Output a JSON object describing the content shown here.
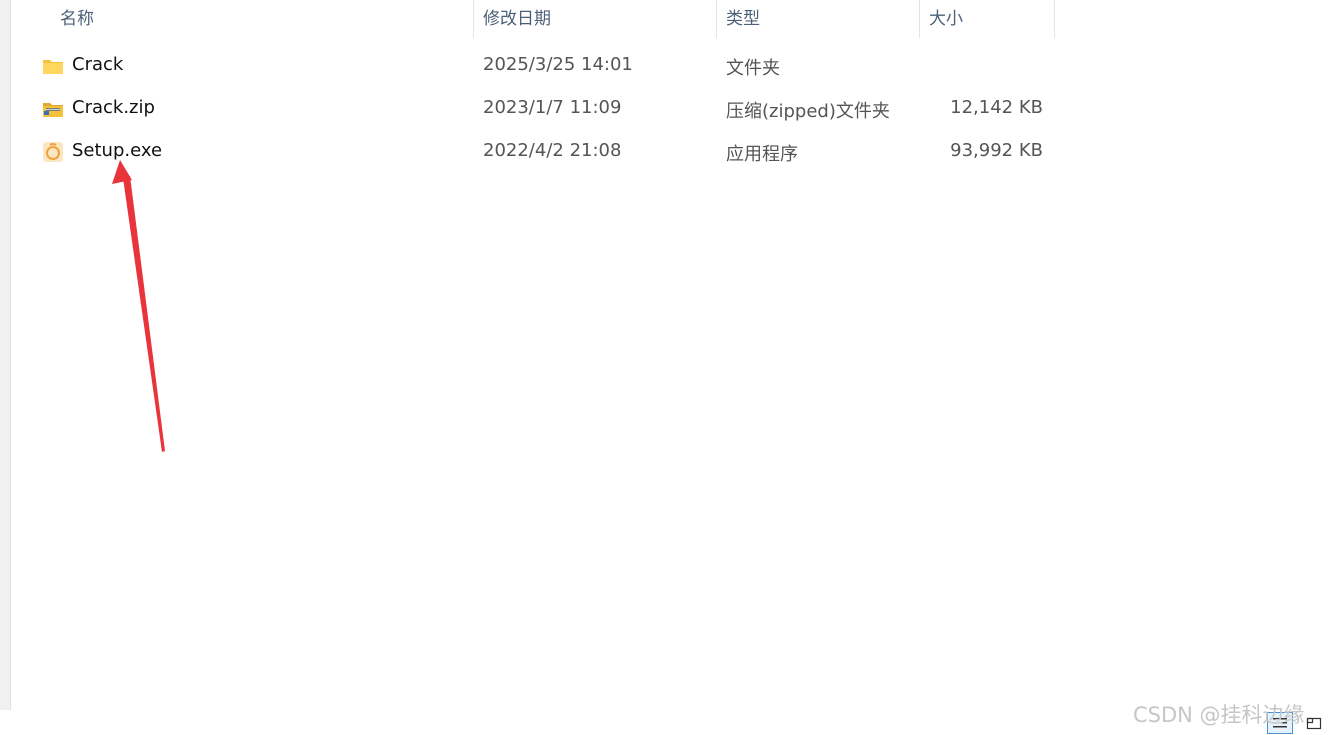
{
  "columns": {
    "name": "名称",
    "date": "修改日期",
    "type": "类型",
    "size": "大小"
  },
  "files": [
    {
      "name": "Crack",
      "date": "2025/3/25 14:01",
      "type": "文件夹",
      "size": "",
      "icon": "folder-icon"
    },
    {
      "name": "Crack.zip",
      "date": "2023/1/7 11:09",
      "type": "压缩(zipped)文件夹",
      "size": "12,142 KB",
      "icon": "zip-folder-icon"
    },
    {
      "name": "Setup.exe",
      "date": "2022/4/2 21:08",
      "type": "应用程序",
      "size": "93,992 KB",
      "icon": "setup-exe-icon"
    }
  ],
  "annotation": {
    "color": "#e8343a",
    "points_to": "Setup.exe"
  },
  "watermark": "CSDN @挂科边缘",
  "colors": {
    "header_text": "#4c607a",
    "selected_view": "#4a90d9",
    "folder": "#f5c23c"
  }
}
